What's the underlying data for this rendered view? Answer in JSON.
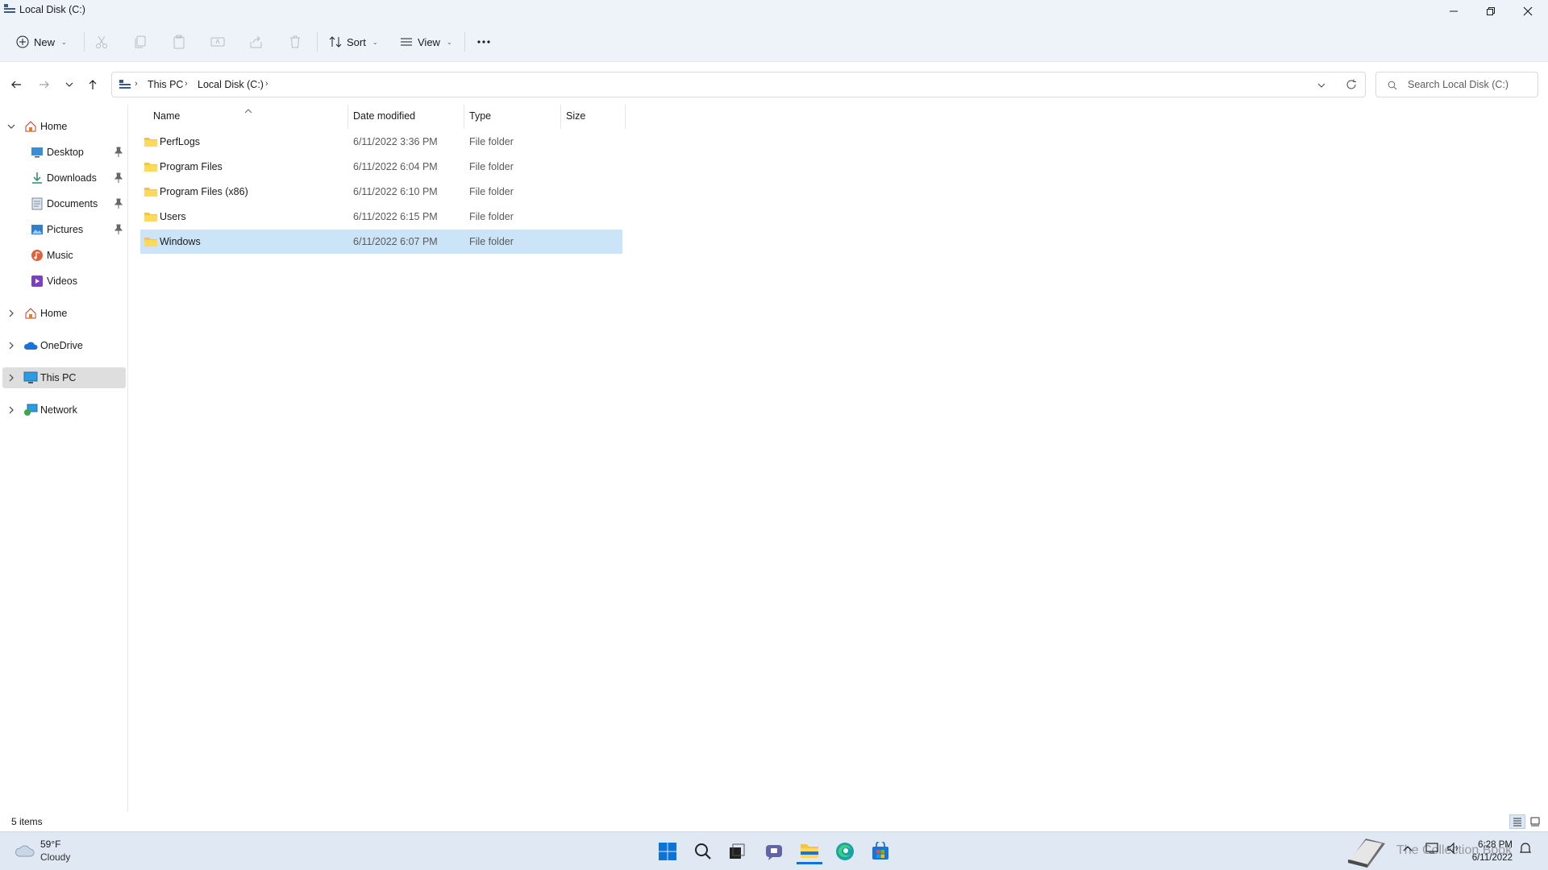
{
  "window": {
    "title": "Local Disk (C:)"
  },
  "toolbar": {
    "new_label": "New",
    "sort_label": "Sort",
    "view_label": "View"
  },
  "address": {
    "crumbs": [
      "This PC",
      "Local Disk (C:)"
    ],
    "search_placeholder": "Search Local Disk (C:)"
  },
  "sidebar": {
    "quick_access": [
      {
        "label": "Home",
        "icon": "home-icon"
      },
      {
        "label": "Desktop",
        "icon": "desktop-icon",
        "pinned": true
      },
      {
        "label": "Downloads",
        "icon": "download-icon",
        "pinned": true
      },
      {
        "label": "Documents",
        "icon": "documents-icon",
        "pinned": true
      },
      {
        "label": "Pictures",
        "icon": "pictures-icon",
        "pinned": true
      },
      {
        "label": "Music",
        "icon": "music-icon"
      },
      {
        "label": "Videos",
        "icon": "videos-icon"
      }
    ],
    "roots": [
      {
        "label": "Home",
        "icon": "home-icon"
      },
      {
        "label": "OneDrive",
        "icon": "onedrive-icon"
      },
      {
        "label": "This PC",
        "icon": "pc-icon",
        "selected": true
      },
      {
        "label": "Network",
        "icon": "network-icon"
      }
    ]
  },
  "columns": {
    "name": "Name",
    "date": "Date modified",
    "type": "Type",
    "size": "Size"
  },
  "files": [
    {
      "name": "PerfLogs",
      "date": "6/11/2022 3:36 PM",
      "type": "File folder"
    },
    {
      "name": "Program Files",
      "date": "6/11/2022 6:04 PM",
      "type": "File folder"
    },
    {
      "name": "Program Files (x86)",
      "date": "6/11/2022 6:10 PM",
      "type": "File folder"
    },
    {
      "name": "Users",
      "date": "6/11/2022 6:15 PM",
      "type": "File folder"
    },
    {
      "name": "Windows",
      "date": "6/11/2022 6:07 PM",
      "type": "File folder",
      "selected": true
    }
  ],
  "status": {
    "item_count": "5 items"
  },
  "taskbar": {
    "weather_temp": "59°F",
    "weather_cond": "Cloudy",
    "time": "6:28 PM",
    "date": "6/11/2022",
    "watermark": "The Collection Book"
  },
  "colors": {
    "accent": "#0067c0",
    "selection": "#cce4f7",
    "folder": "#f4c542",
    "chrome_bg": "#eef3f9"
  }
}
